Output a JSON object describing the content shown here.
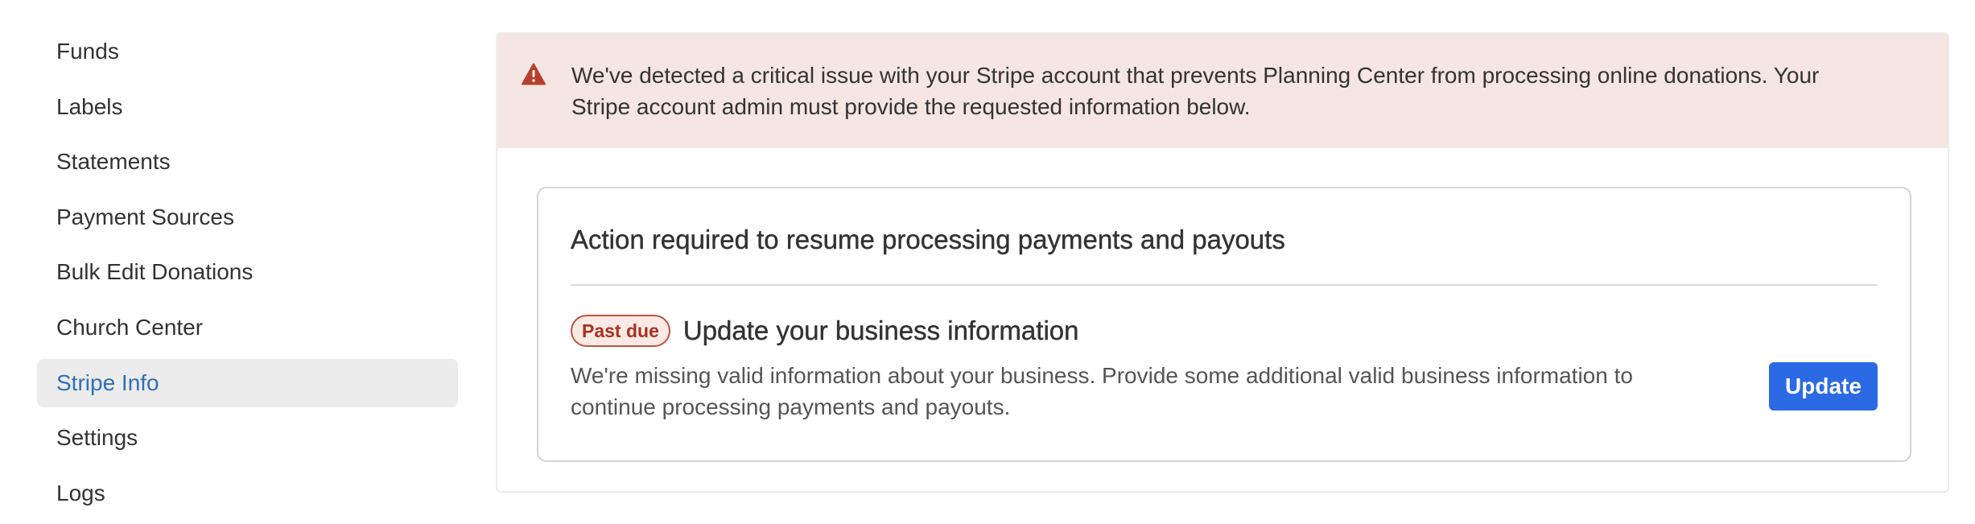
{
  "sidebar": {
    "items": [
      {
        "label": "Funds"
      },
      {
        "label": "Labels"
      },
      {
        "label": "Statements"
      },
      {
        "label": "Payment Sources"
      },
      {
        "label": "Bulk Edit Donations"
      },
      {
        "label": "Church Center"
      },
      {
        "label": "Stripe Info",
        "active": true
      },
      {
        "label": "Settings"
      },
      {
        "label": "Logs"
      }
    ]
  },
  "alert": {
    "icon": "warning-triangle-icon",
    "color": "#b5412d",
    "background": "#f5e5e3",
    "message": "We've detected a critical issue with your Stripe account that prevents Planning Center from processing online donations. Your Stripe account admin must provide the requested information below."
  },
  "card": {
    "title": "Action required to resume processing payments and payouts",
    "task": {
      "badge": "Past due",
      "title": "Update your business information",
      "description": "We're missing valid information about your business. Provide some additional valid business information to continue processing payments and payouts.",
      "button_label": "Update",
      "button_color": "#2b6ae4"
    }
  }
}
